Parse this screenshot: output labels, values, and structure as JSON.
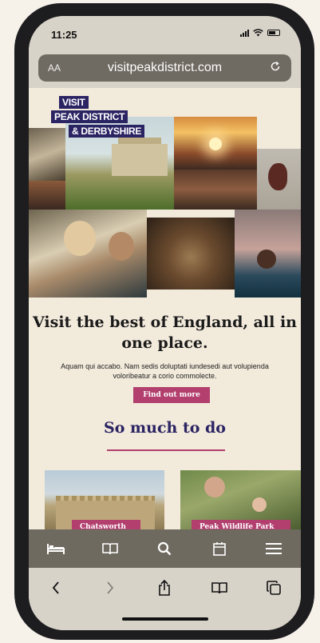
{
  "status_bar": {
    "time": "11:25"
  },
  "browser": {
    "text_size_label": "AA",
    "url": "visitpeakdistrict.com"
  },
  "logo": {
    "line1": "VISIT",
    "line2": "PEAK DISTRICT",
    "line3": "& DERBYSHIRE"
  },
  "hero": {
    "headline": "Visit the best of England, all in one place.",
    "body": "Aquam qui accabo. Nam sedis doluptati iundesedi aut volupienda voloribeatur a corio commolecte.",
    "cta_label": "Find out more"
  },
  "section": {
    "title": "So much to do",
    "cards": [
      {
        "label": "Chatsworth"
      },
      {
        "label": "Peak Wildlife Park"
      }
    ]
  },
  "site_nav": {
    "items": [
      {
        "icon": "bed-icon"
      },
      {
        "icon": "open-book-icon"
      },
      {
        "icon": "search-icon"
      },
      {
        "icon": "calendar-icon"
      },
      {
        "icon": "menu-icon"
      }
    ]
  },
  "toolbar": {
    "items": [
      {
        "icon": "back-icon"
      },
      {
        "icon": "forward-icon"
      },
      {
        "icon": "share-icon"
      },
      {
        "icon": "bookmarks-icon"
      },
      {
        "icon": "tabs-icon"
      }
    ]
  },
  "colors": {
    "brand_navy": "#2b2463",
    "brand_pink": "#b23f6e",
    "page_background": "#f2eadb",
    "site_nav_background": "#6f6a60"
  }
}
